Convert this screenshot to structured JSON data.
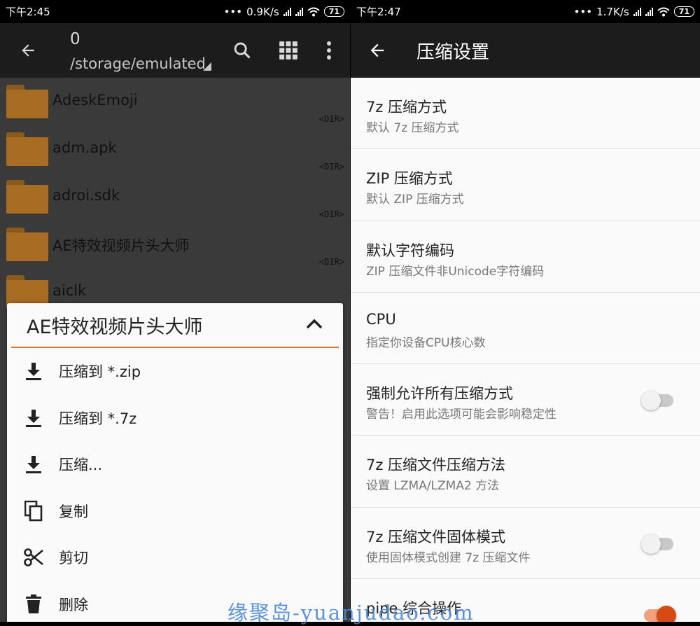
{
  "left": {
    "status": {
      "time": "下午2:45",
      "speed": "0.9K/s",
      "battery": "71"
    },
    "appbar": {
      "count": "0",
      "path": "/storage/emulated"
    },
    "files": [
      {
        "name": "AdeskEmoji",
        "tag": "<DIR>"
      },
      {
        "name": "adm.apk",
        "tag": "<DIR>"
      },
      {
        "name": "adroi.sdk",
        "tag": "<DIR>"
      },
      {
        "name": "AE特效视频片头大师",
        "tag": "<DIR>"
      },
      {
        "name": "aiclk",
        "tag": ""
      }
    ],
    "sheet": {
      "title": "AE特效视频片头大师",
      "items": [
        {
          "label": "压缩到 *.zip",
          "icon": "download-icon"
        },
        {
          "label": "压缩到 *.7z",
          "icon": "download-icon"
        },
        {
          "label": "压缩...",
          "icon": "download-icon"
        },
        {
          "label": "复制",
          "icon": "copy-icon"
        },
        {
          "label": "剪切",
          "icon": "cut-icon"
        },
        {
          "label": "删除",
          "icon": "delete-icon"
        }
      ]
    }
  },
  "right": {
    "status": {
      "time": "下午2:47",
      "speed": "1.7K/s",
      "battery": "71"
    },
    "title": "压缩设置",
    "settings": [
      {
        "title": "7z 压缩方式",
        "subtitle": "默认 7z 压缩方式"
      },
      {
        "title": "ZIP 压缩方式",
        "subtitle": "默认 ZIP 压缩方式"
      },
      {
        "title": "默认字符编码",
        "subtitle": "ZIP 压缩文件非Unicode字符编码"
      },
      {
        "title": "CPU",
        "subtitle": "指定你设备CPU核心数"
      },
      {
        "title": "强制允许所有压缩方式",
        "subtitle": "警告！启用此选项可能会影响稳定性",
        "toggle": false
      },
      {
        "title": "7z 压缩文件压缩方法",
        "subtitle": "设置 LZMA/LZMA2 方法"
      },
      {
        "title": "7z 压缩文件固体模式",
        "subtitle": "使用固体模式创建 7z 压缩文件",
        "toggle": false
      },
      {
        "title": "pipe 综合操作",
        "subtitle": "",
        "toggle": true
      }
    ]
  },
  "watermark": "缘聚岛-yuanjudao.com",
  "colors": {
    "accent": "#e07a2e",
    "switch_on": "#d64a17",
    "folder": "#a86c22"
  }
}
